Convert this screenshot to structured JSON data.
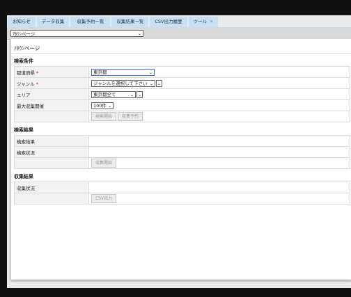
{
  "tabs": [
    {
      "label": "お知らせ"
    },
    {
      "label": "データ収集"
    },
    {
      "label": "収集予約一覧"
    },
    {
      "label": "収集結果一覧"
    },
    {
      "label": "CSV出力履歴"
    },
    {
      "label": "ツール"
    }
  ],
  "page_select": {
    "value": "ｱﾀｳﾝページ"
  },
  "panel_title": "ｱﾀｳﾝページ",
  "search_conditions": {
    "title": "検索条件",
    "prefecture": {
      "label": "都道府県",
      "required": "*",
      "value": "東京都"
    },
    "genre": {
      "label": "ジャンル",
      "required": "*",
      "value": "ジャンルを選択して下さい"
    },
    "area": {
      "label": "エリア",
      "value": "東京都全て"
    },
    "max_count": {
      "label": "最大収集開催",
      "value": "100件"
    },
    "buttons": {
      "start": "検索開始",
      "reserve": "収集予約"
    }
  },
  "search_results": {
    "title": "検索結果",
    "result_label": "検索結果",
    "status_label": "検索状況",
    "collect_button": "収集開始"
  },
  "collect_results": {
    "title": "収集結果",
    "status_label": "収集状況",
    "csv_button": "CSV出力"
  }
}
